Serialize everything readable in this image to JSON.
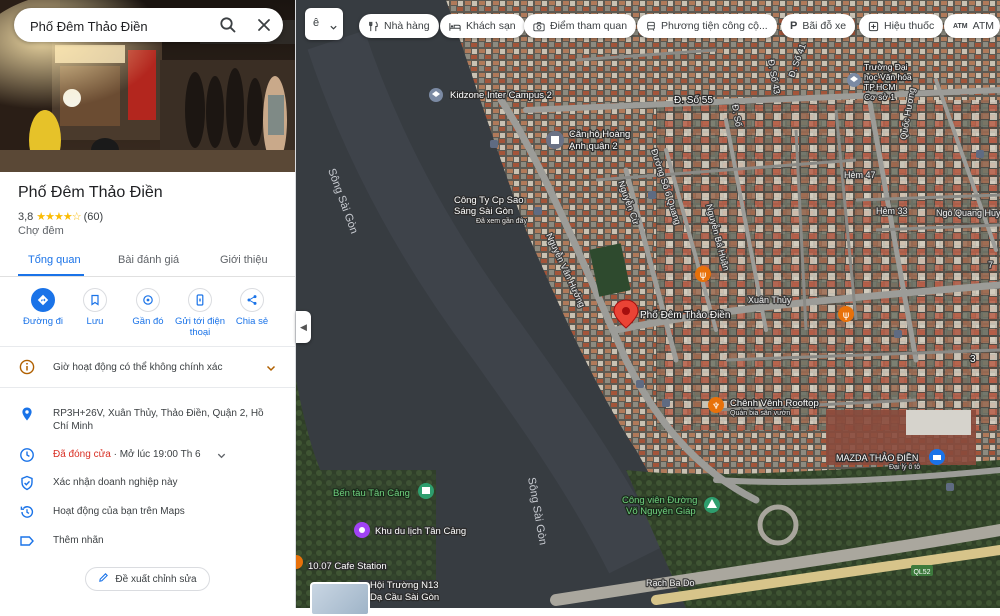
{
  "search": {
    "value": "Phố Đêm Thảo Điền",
    "search_icon": "search-icon",
    "clear_icon": "close-icon"
  },
  "place": {
    "name": "Phố Đêm Thảo Điền",
    "rating": "3,8",
    "stars": "★★★★☆",
    "review_count": "(60)",
    "category": "Chợ đêm"
  },
  "tabs": [
    {
      "label": "Tổng quan",
      "active": true
    },
    {
      "label": "Bài đánh giá",
      "active": false
    },
    {
      "label": "Giới thiệu",
      "active": false
    }
  ],
  "actions": [
    {
      "label": "Đường đi",
      "icon": "directions-icon"
    },
    {
      "label": "Lưu",
      "icon": "bookmark-icon"
    },
    {
      "label": "Gần đó",
      "icon": "nearby-icon"
    },
    {
      "label": "Gửi tới điện thoại",
      "icon": "send-to-phone-icon"
    },
    {
      "label": "Chia sẻ",
      "icon": "share-icon"
    }
  ],
  "hours_warning": "Giờ hoạt động có thể không chính xác",
  "details": {
    "address": "RP3H+26V, Xuân Thủy, Thảo Điền, Quận 2, Hồ Chí Minh",
    "status_closed": "Đã đóng cửa",
    "status_open": " · Mở lúc 19:00 Th 6",
    "claim": "Xác nhận doanh nghiệp này",
    "activity": "Hoạt động của bạn trên Maps",
    "add_label": "Thêm nhãn"
  },
  "suggest_edit": "Đề xuất chỉnh sửa",
  "map": {
    "layers_label": "ê",
    "chips": [
      {
        "label": "Nhà hàng",
        "icon": "restaurant-icon"
      },
      {
        "label": "Khách sạn",
        "icon": "hotel-icon"
      },
      {
        "label": "Điểm tham quan",
        "icon": "camera-icon"
      },
      {
        "label": "Phương tiện công cộ...",
        "icon": "transit-icon"
      },
      {
        "label": "Bãi đỗ xe",
        "icon": "parking-icon"
      },
      {
        "label": "Hiệu thuốc",
        "icon": "pharmacy-icon"
      },
      {
        "label": "ATM",
        "icon": "atm-icon"
      }
    ],
    "labels": {
      "kidzone": "Kidzone Inter Campus 2",
      "d55": "Đ. Số 55",
      "canho1": "Căn hộ Hoàng",
      "canho2": "Anh quận 2",
      "truong1": "Trường Đại",
      "truong2": "học Văn hóa",
      "truong3": "TP.HCM",
      "truong4": "Cơ sở 1",
      "congty1": "Công Ty Cp Sao",
      "congty2": "Sáng Sài Gòn",
      "congty3": "Đã xem gần đây",
      "song1": "Sông Sài Gòn",
      "song2": "Sông Sài Gòn",
      "nguyenvanhuong": "Nguyễn Văn Hưởng",
      "nguyencu": "Nguyễn Cừ",
      "duongsoquang": "Đường Số 6 Quang",
      "nguyenbahuan": "Nguyễn Bá Huân",
      "quochuong": "Quốc Hương",
      "hem47": "Hẻm 47",
      "hem33": "Hẻm 33",
      "ngoquanghuy": "Ngô Quang Huy",
      "xuanthuy": "Xuân Thủy",
      "ds41": "Đ. Số 41",
      "ds43": "Đ. Số 43",
      "ds": "Đ. Số",
      "pin": "Phố Đêm Thảo Điền",
      "chenh1": "Chênh Vênh Rooftop",
      "chenh2": "Quán bia sân vườn",
      "mazda1": "MAZDA THẢO ĐIỀN",
      "mazda2": "Đại lý ô tô",
      "benTau": "Bến tàu Tân Cảng",
      "congVien1": "Công viên Đường",
      "congVien2": "Võ Nguyên Giáp",
      "khuDuLich": "Khu du lịch Tân Cảng",
      "cafe": "10.07 Cafe Station",
      "hoitruong1": "Hội Trường N13",
      "hoitruong2": "Dạ Cầu Sài Gòn",
      "rachbado": "Rạch Ba Do",
      "ql52": "QL52",
      "three": "3",
      "seven": "7"
    }
  },
  "colors": {
    "accent": "#1a73e8",
    "closed": "#d93025",
    "star": "#fbbc04",
    "pin": "#ea4335",
    "poi_orange": "#e8710a"
  }
}
